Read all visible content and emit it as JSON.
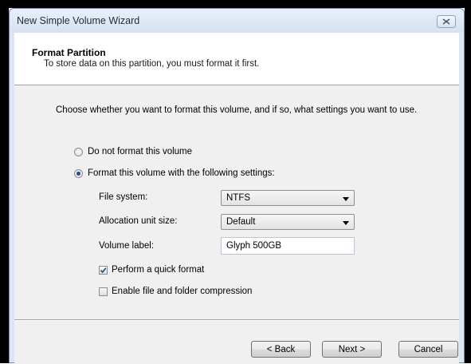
{
  "window": {
    "title": "New Simple Volume Wizard"
  },
  "header": {
    "title": "Format Partition",
    "subtitle": "To store data on this partition, you must format it first."
  },
  "instructions": "Choose whether you want to format this volume, and if so, what settings you want to use.",
  "options": {
    "no_format_label": "Do not format this volume",
    "format_label": "Format this volume with the following settings:",
    "selected": "format"
  },
  "settings": {
    "file_system_label": "File system:",
    "file_system_value": "NTFS",
    "allocation_label": "Allocation unit size:",
    "allocation_value": "Default",
    "volume_label_label": "Volume label:",
    "volume_label_value": "Glyph 500GB",
    "quick_format_label": "Perform a quick format",
    "quick_format_checked": true,
    "compression_label": "Enable file and folder compression",
    "compression_checked": false
  },
  "buttons": {
    "back": "< Back",
    "next": "Next >",
    "cancel": "Cancel"
  },
  "colors": {
    "title_bar": "#dbe6f2",
    "radio_dot": "#1d4f8f",
    "check_mark": "#2a4f8a"
  }
}
